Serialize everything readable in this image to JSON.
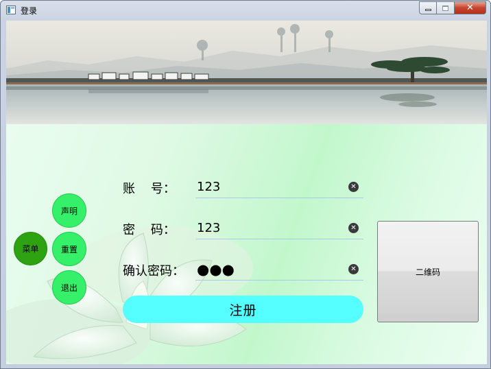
{
  "window": {
    "title": "登录",
    "controls": {
      "close_glyph": "✕"
    }
  },
  "menu": {
    "main_label": "菜单",
    "items": [
      {
        "label": "声明"
      },
      {
        "label": "重置"
      },
      {
        "label": "退出"
      }
    ],
    "colors": {
      "main": "#2ea312",
      "items": "#37f06a"
    }
  },
  "form": {
    "account": {
      "label": "账    号：",
      "value": "123"
    },
    "password": {
      "label": "密    码：",
      "value": "123"
    },
    "confirm_password": {
      "label": "确认密码：",
      "masked_value": "●●●"
    },
    "clear_icon": "✕",
    "register_label": "注册",
    "register_color": "#55ffff"
  },
  "qr": {
    "label": "二维码"
  }
}
